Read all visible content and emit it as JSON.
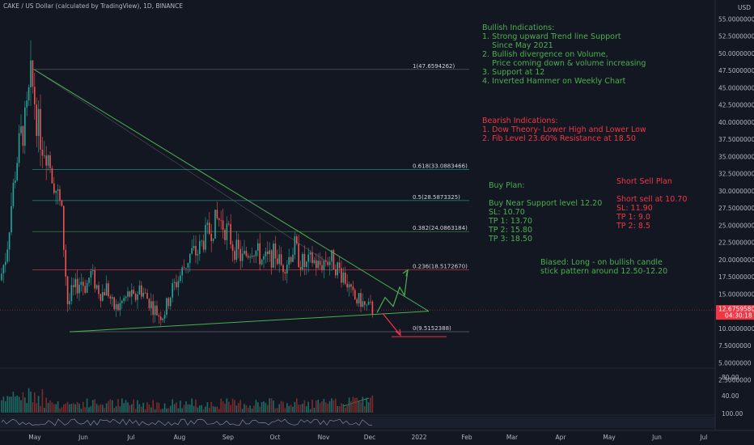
{
  "header": {
    "title": "CAKE / US Dollar (calculated by TradingView), 1D, BINANCE"
  },
  "notes": {
    "bullish": "Bullish Indications:\n1. Strong upward Trend line Support\n    Since May 2021\n2. Bullish divergence on Volume,\n    Price coming down & volume increasing\n3. Support at 12\n4. Inverted Hammer on Weekly Chart",
    "bearish": "Bearish Indications:\n1. Dow Theory- Lower High and Lower Low\n2. Fib Level 23.60% Resistance at 18.50",
    "buy_plan": "Buy Plan:\n\nBuy Near Support level 12.20\nSL: 10.70\nTP 1: 13.70\nTP 2: 15.80\nTP 3: 18.50",
    "short_plan": "Short Sell Plan\n\nShort sell at 10.70\nSL: 11.90\nTP 1: 9.0\nTP 2: 8.5",
    "bias": "Biased: Long - on bullish candle\nstick pattern around 12.50-12.20"
  },
  "colors": {
    "background": "#131722",
    "up": "#26a69a",
    "down": "#ef5350",
    "annotation_green": "#4caf50",
    "annotation_red": "#f23645"
  },
  "price_axis": {
    "unit": "USD",
    "ticks": [
      "55.0000000",
      "52.5000000",
      "50.0000000",
      "47.5000000",
      "45.0000000",
      "42.5000000",
      "40.0000000",
      "37.5000000",
      "35.0000000",
      "32.5000000",
      "30.0000000",
      "27.5000000",
      "25.0000000",
      "22.5000000",
      "20.0000000",
      "17.5000000",
      "15.0000000",
      "12.5000000",
      "10.0000000",
      "7.5000000",
      "5.0000000",
      "2.5000000"
    ],
    "current_price": "12.6759580",
    "countdown": "04:30:18"
  },
  "volume_axis": {
    "ticks": [
      "80.00",
      "40.00"
    ],
    "oscillator_tick": "100.00"
  },
  "time_axis": {
    "ticks": [
      "May",
      "Jun",
      "Jul",
      "Aug",
      "Sep",
      "Oct",
      "Nov",
      "Dec",
      "2022",
      "Feb",
      "Mar",
      "Apr",
      "May",
      "Jun",
      "Jul"
    ]
  },
  "chart_data": {
    "type": "candlestick",
    "title": "CAKE / US Dollar (calculated by TradingView), 1D, BINANCE",
    "ylabel": "USD",
    "ylim": [
      0,
      56
    ],
    "grid": false,
    "fib_levels": [
      {
        "label": "1(47.6594262)",
        "ratio": 1,
        "value": 47.6594262
      },
      {
        "label": "0.618(33.0883466)",
        "ratio": 0.618,
        "value": 33.0883466
      },
      {
        "label": "0.5(28.5873325)",
        "ratio": 0.5,
        "value": 28.5873325
      },
      {
        "label": "0.382(24.0863184)",
        "ratio": 0.382,
        "value": 24.0863184
      },
      {
        "label": "0.236(18.5172670)",
        "ratio": 0.236,
        "value": 18.517267
      },
      {
        "label": "0(9.5152388)",
        "ratio": 0,
        "value": 9.5152388
      }
    ],
    "trendlines": [
      {
        "name": "resistance",
        "from": [
          "late Apr 2021",
          47.6
        ],
        "to": [
          "late Dec 2021",
          12.5
        ]
      },
      {
        "name": "support",
        "from": [
          "mid May 2021",
          9.5
        ],
        "to": [
          "late Dec 2021",
          12.5
        ]
      }
    ],
    "monthly_closes_approx": [
      {
        "month": "May",
        "close": 20
      },
      {
        "month": "Jun",
        "close": 14
      },
      {
        "month": "Jul",
        "close": 11
      },
      {
        "month": "Aug",
        "close": 21
      },
      {
        "month": "Sep",
        "close": 22
      },
      {
        "month": "Oct",
        "close": 20
      },
      {
        "month": "Nov",
        "close": 17
      },
      {
        "month": "Dec",
        "close": 12.7
      }
    ],
    "projections": [
      {
        "name": "bullish path",
        "color": "#4caf50",
        "points": [
          12.3,
          14.5,
          13.2,
          16.0,
          14.8,
          18.5
        ]
      },
      {
        "name": "bearish path",
        "color": "#f23645",
        "points": [
          12.2,
          9.0
        ]
      }
    ]
  }
}
